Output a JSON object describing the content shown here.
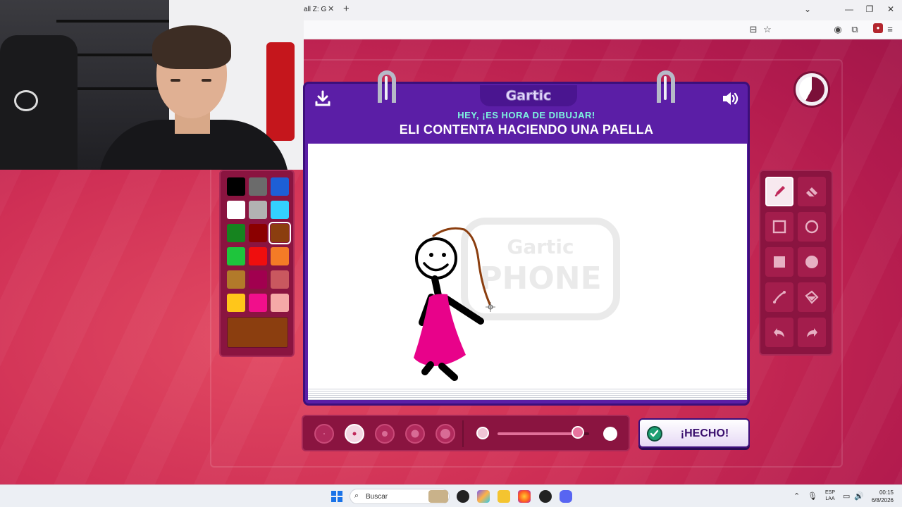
{
  "browser": {
    "tab_title": "all Z: Gol",
    "tab_close": "✕",
    "new_tab": "+",
    "tab_list": "⌄",
    "win_min": "—",
    "win_max": "❐",
    "win_close": "✕"
  },
  "game": {
    "logo": "Gartic",
    "subtitle": "HEY, ¡ES HORA DE DIBUJAR!",
    "prompt": "ELI CONTENTA HACIENDO UNA PAELLA",
    "watermark_line1": "Gartic",
    "watermark_line2": "PHONE",
    "done_label": "¡HECHO!",
    "timer_fraction_remaining": 0.42,
    "brush_sizes": 5,
    "brush_selected_index": 1,
    "opacity_level": 0.88,
    "selected_color": "#8b3e0f",
    "palette": [
      [
        "#000000",
        "#6b6b6b",
        "#1d5fd6"
      ],
      [
        "#ffffff",
        "#b2b2b2",
        "#33d0ff"
      ],
      [
        "#16841f",
        "#8b0000",
        "#8b3e0f"
      ],
      [
        "#1ec53c",
        "#ef0e0e",
        "#f47b26"
      ],
      [
        "#b27a2a",
        "#a1004f",
        "#c9585f"
      ],
      [
        "#ffc61a",
        "#f10f8b",
        "#f5a9a7"
      ]
    ],
    "tools": [
      {
        "name": "pencil-tool",
        "icon": "pencil-icon",
        "active": true
      },
      {
        "name": "eraser-tool",
        "icon": "eraser-icon",
        "active": false
      },
      {
        "name": "rectangle-outline-tool",
        "icon": "square-outline-icon",
        "active": false
      },
      {
        "name": "circle-outline-tool",
        "icon": "circle-outline-icon",
        "active": false
      },
      {
        "name": "rectangle-fill-tool",
        "icon": "square-fill-icon",
        "active": false
      },
      {
        "name": "circle-fill-tool",
        "icon": "circle-fill-icon",
        "active": false
      },
      {
        "name": "line-tool",
        "icon": "line-icon",
        "active": false
      },
      {
        "name": "fill-bucket-tool",
        "icon": "bucket-icon",
        "active": false
      },
      {
        "name": "undo-tool",
        "icon": "undo-icon",
        "active": false
      },
      {
        "name": "redo-tool",
        "icon": "redo-icon",
        "active": false
      }
    ]
  },
  "taskbar": {
    "search_placeholder": "Buscar",
    "lang_top": "ESP",
    "lang_bottom": "LAA",
    "time": "00:15",
    "date": "6/8/2026"
  }
}
